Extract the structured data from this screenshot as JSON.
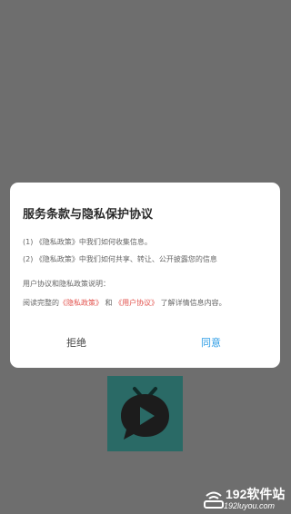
{
  "dialog": {
    "title": "服务条款与隐私保护协议",
    "item1": "(1) 《隐私政策》中我们如何收集信息。",
    "item2": "(2) 《隐私政策》中我们如何共享、转让、公开披露您的信息",
    "note": "用户协议和隐私政策说明：",
    "read_prefix": "阅读完整的",
    "privacy_link": "《隐私政策》",
    "and": " 和 ",
    "user_link": "《用户协议》",
    "read_suffix": " 了解详情信息内容。",
    "reject_label": "拒绝",
    "agree_label": "同意"
  },
  "app_icon": {
    "name": "tv-chat-app-icon",
    "color": "#2a6a66"
  },
  "watermark": {
    "title": "192软件站",
    "url": "192luyou.com"
  },
  "colors": {
    "overlay": "#6e6e6e",
    "link": "#e2524d",
    "agree": "#2f9ee6"
  }
}
